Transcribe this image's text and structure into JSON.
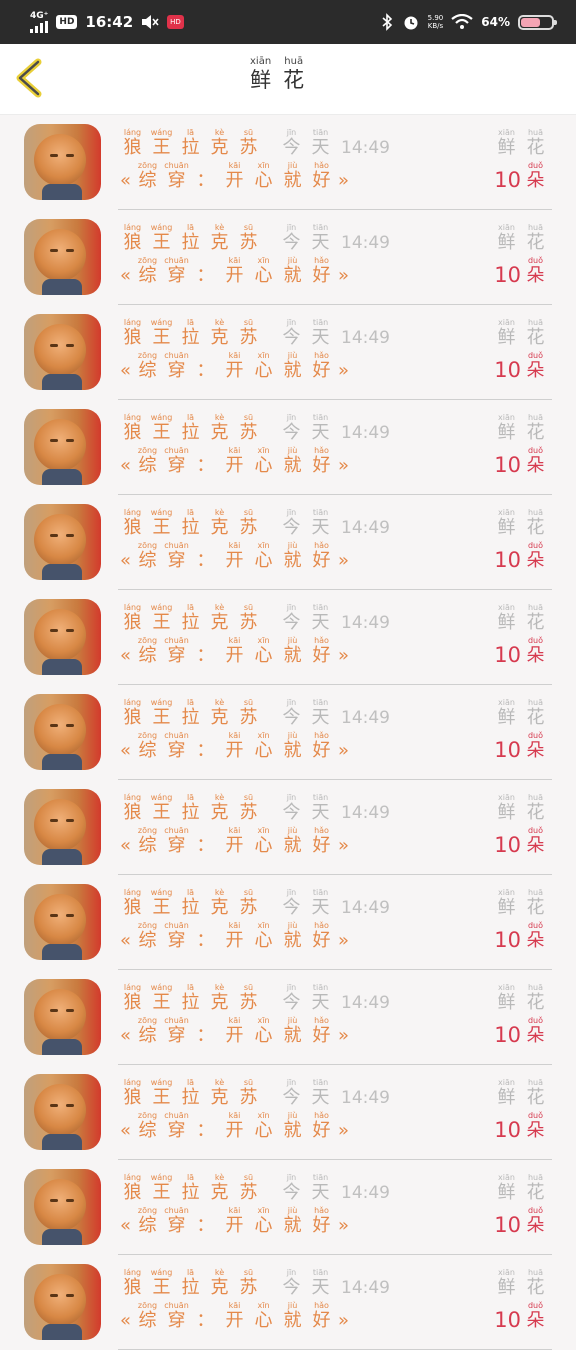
{
  "status_bar": {
    "network": "4G⁺",
    "hd": "HD",
    "time": "16:42",
    "notif_badge": "HD",
    "net_speed_value": "5.90",
    "net_speed_unit": "KB/s",
    "battery_percent": "64%",
    "battery_level": 0.64
  },
  "header": {
    "title_pinyin": [
      "xiān",
      "huā"
    ],
    "title_chars": [
      "鲜",
      "花"
    ]
  },
  "row_template": {
    "name": [
      {
        "py": "láng",
        "hz": "狼"
      },
      {
        "py": "wáng",
        "hz": "王"
      },
      {
        "py": "lā",
        "hz": "拉"
      },
      {
        "py": "kè",
        "hz": "克"
      },
      {
        "py": "sū",
        "hz": "苏"
      }
    ],
    "day": [
      {
        "py": "jīn",
        "hz": "今"
      },
      {
        "py": "tiān",
        "hz": "天"
      }
    ],
    "time": "14:49",
    "label": [
      {
        "py": "xiān",
        "hz": "鲜"
      },
      {
        "py": "huā",
        "hz": "花"
      }
    ],
    "open_quote": "«",
    "close_quote": "»",
    "title": [
      {
        "py": "zōng",
        "hz": "综"
      },
      {
        "py": "chuān",
        "hz": "穿"
      },
      {
        "py": "",
        "hz": "："
      },
      {
        "py": "kāi",
        "hz": "开"
      },
      {
        "py": "xīn",
        "hz": "心"
      },
      {
        "py": "jiù",
        "hz": "就"
      },
      {
        "py": "hǎo",
        "hz": "好"
      }
    ],
    "count": "10",
    "unit": {
      "py": "duǒ",
      "hz": "朵"
    }
  },
  "rows_count": 13
}
